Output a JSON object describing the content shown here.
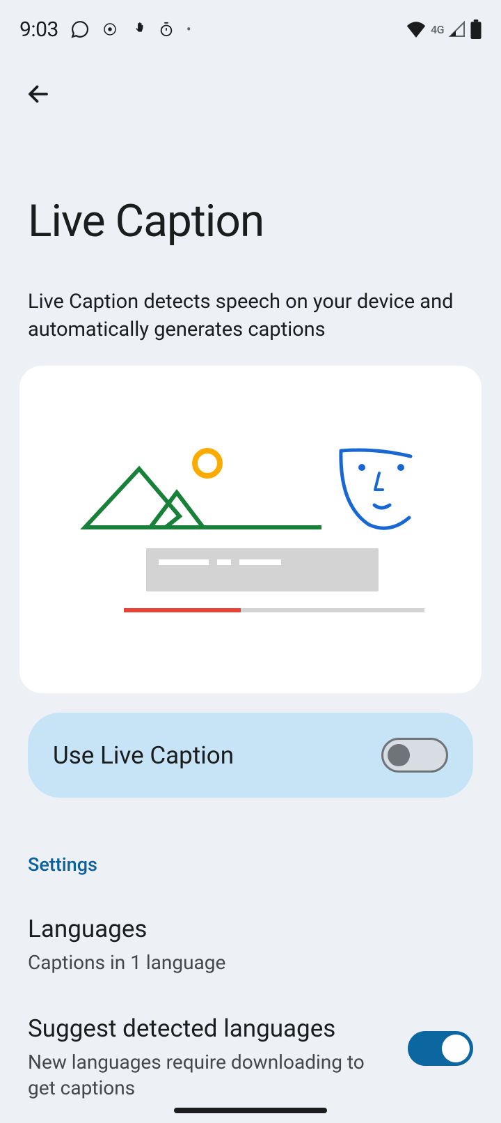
{
  "status": {
    "time": "9:03",
    "network_label": "4G"
  },
  "page": {
    "title": "Live Caption",
    "description": "Live Caption detects speech on your device and automatically generates captions"
  },
  "main_toggle": {
    "label": "Use Live Caption",
    "enabled": false
  },
  "section": {
    "header": "Settings"
  },
  "settings": {
    "languages": {
      "title": "Languages",
      "subtitle": "Captions in 1 language"
    },
    "suggest": {
      "title": "Suggest detected languages",
      "subtitle": "New languages require downloading to get captions",
      "enabled": true
    }
  }
}
